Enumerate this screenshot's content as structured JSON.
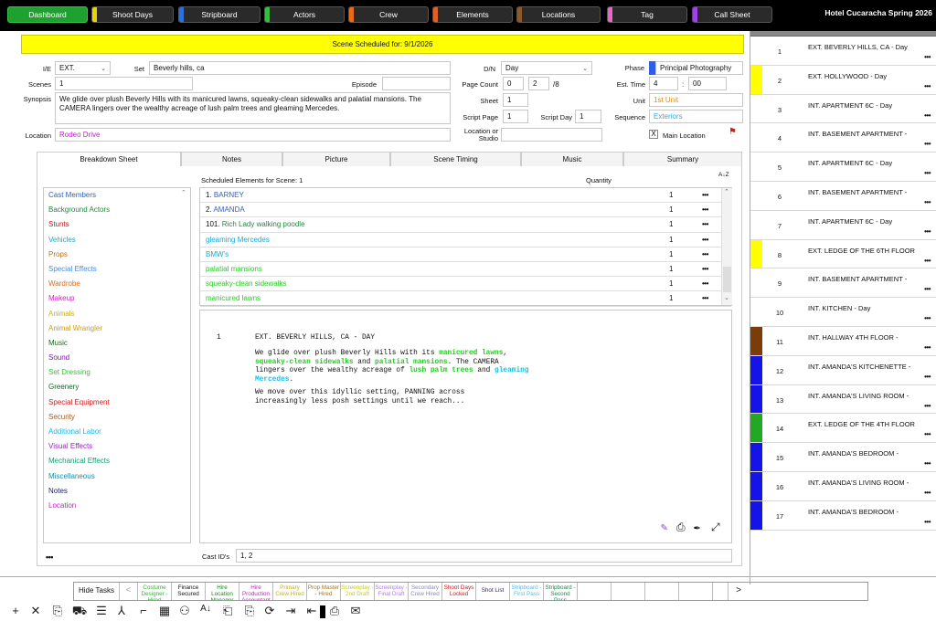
{
  "topnav": {
    "tabs": [
      {
        "label": "Dashboard",
        "color": "#1fa12f",
        "active": true
      },
      {
        "label": "Shoot Days",
        "color": "#e8d400"
      },
      {
        "label": "Stripboard",
        "color": "#2f6fd6"
      },
      {
        "label": "Actors",
        "color": "#3dbb3d"
      },
      {
        "label": "Crew",
        "color": "#e86b1a"
      },
      {
        "label": "Elements",
        "color": "#e0602a"
      },
      {
        "label": "Locations",
        "color": "#8a5a2a"
      },
      {
        "label": "Tag",
        "color": "#e868c8"
      },
      {
        "label": "Call Sheet",
        "color": "#a040e8"
      }
    ],
    "project_title": "Hotel Cucaracha Spring 2026"
  },
  "banner": "Scene Scheduled for: 9/1/2026",
  "form": {
    "ie_label": "I/E",
    "ie_value": "EXT.",
    "set_label": "Set",
    "set_value": "Beverly hills, ca",
    "dn_label": "D/N",
    "dn_value": "Day",
    "phase_label": "Phase",
    "phase_value": "Principal Photography",
    "scenes_label": "Scenes",
    "scenes_value": "1",
    "episode_label": "Episode",
    "episode_value": "",
    "pagecount_label": "Page Count",
    "pagecount_whole": "0",
    "pagecount_num": "2",
    "pagecount_den": "/8",
    "esttime_label": "Est. Time",
    "esttime_h": "4",
    "esttime_sep": ":",
    "esttime_m": "00",
    "synopsis_label": "Synopsis",
    "synopsis_value": "We glide over plush Beverly Hills with its manicured lawns, squeaky-clean sidewalks and palatial mansions. The CAMERA lingers over the wealthy acreage of lush palm trees and gleaming Mercedes.",
    "sheet_label": "Sheet",
    "sheet_value": "1",
    "unit_label": "Unit",
    "unit_value": "1st Unit",
    "scriptpage_label": "Script Page",
    "scriptpage_value": "1",
    "scriptday_label": "Script Day",
    "scriptday_value": "1",
    "sequence_label": "Sequence",
    "sequence_value": "Exteriors",
    "location_label": "Location",
    "location_value": "Rodeo Drive",
    "locstudio_label": "Location or Studio",
    "locstudio_value": "",
    "mainloc_check": "X",
    "mainloc_label": "Main Location"
  },
  "tabs": [
    "Breakdown Sheet",
    "Notes",
    "Picture",
    "Scene Timing",
    "Music",
    "Summary"
  ],
  "elements_header": "Scheduled Elements for Scene: 1",
  "quantity_header": "Quantity",
  "sort_glyph": "A↓Z",
  "categories": [
    {
      "label": "Cast Members",
      "color": "#2f5fc8"
    },
    {
      "label": "Background Actors",
      "color": "#1e8a3e"
    },
    {
      "label": "Stunts",
      "color": "#c01a1a"
    },
    {
      "label": "Vehicles",
      "color": "#17a8d8"
    },
    {
      "label": "Props",
      "color": "#b8741a"
    },
    {
      "label": "Special Effects",
      "color": "#4a8ad8"
    },
    {
      "label": "Wardrobe",
      "color": "#e06a1a"
    },
    {
      "label": "Makeup",
      "color": "#d81ac8"
    },
    {
      "label": "Animals",
      "color": "#c8b01a"
    },
    {
      "label": "Animal Wrangler",
      "color": "#c89a1a"
    },
    {
      "label": "Music",
      "color": "#1a6a1a"
    },
    {
      "label": "Sound",
      "color": "#7a1aa8"
    },
    {
      "label": "Set Dressing",
      "color": "#2ac82a"
    },
    {
      "label": "Greenery",
      "color": "#0a6a1a"
    },
    {
      "label": "Special Equipment",
      "color": "#d81a1a"
    },
    {
      "label": "Security",
      "color": "#a8581a"
    },
    {
      "label": "Additional Labor",
      "color": "#1ab8e8"
    },
    {
      "label": "Visual Effects",
      "color": "#9a1ac8"
    },
    {
      "label": "Mechanical Effects",
      "color": "#1a9a6a"
    },
    {
      "label": "Miscellaneous",
      "color": "#1a8aa8"
    },
    {
      "label": "Notes",
      "color": "#1a1a6a"
    },
    {
      "label": "Location",
      "color": "#c81ad8"
    }
  ],
  "categories_more": "•••",
  "elements": [
    {
      "prefix": "1. ",
      "name": "BARNEY",
      "color": "#2f5fc8",
      "qty": "1",
      "more": "•••"
    },
    {
      "prefix": "2. ",
      "name": "AMANDA",
      "color": "#2f5fc8",
      "qty": "1",
      "more": "•••"
    },
    {
      "prefix": "101. ",
      "name": "Rich Lady walking poodle",
      "color": "#1e8a3e",
      "qty": "1",
      "more": "•••"
    },
    {
      "prefix": "",
      "name": "gleaming Mercedes",
      "color": "#17a8d8",
      "qty": "1",
      "more": "•••"
    },
    {
      "prefix": "",
      "name": "BMW's",
      "color": "#17a8d8",
      "qty": "1",
      "more": "•••"
    },
    {
      "prefix": "",
      "name": "palatial mansions",
      "color": "#2ac82a",
      "qty": "1",
      "more": "•••"
    },
    {
      "prefix": "",
      "name": "squeaky-clean sidewalks",
      "color": "#2ac82a",
      "qty": "1",
      "more": "•••"
    },
    {
      "prefix": "",
      "name": "manicured lawns",
      "color": "#2ac82a",
      "qty": "1",
      "more": "•••"
    }
  ],
  "script": {
    "scene_num": "1",
    "heading": "EXT. BEVERLY HILLS, CA - DAY",
    "p1_a": "We glide over plush Beverly Hills with its ",
    "p1_hl1": "manicured lawns",
    "p1_b": ", ",
    "p1_hl2": "squeaky-clean sidewalks",
    "p1_c": " and ",
    "p1_hl3": "palatial mansions",
    "p1_d": ". The CAMERA lingers over the wealthy acreage of ",
    "p1_hl4": "lush palm trees",
    "p1_e": " and ",
    "p1_hl5": "gleaming Mercedes",
    "p1_f": ".",
    "p2": "We move over this idyllic setting, PANNING across increasingly less posh settings until we reach..."
  },
  "castids_label": "Cast ID's",
  "castids_value": "1, 2",
  "stripboard": [
    {
      "num": "1",
      "title": "EXT. BEVERLY HILLS, CA  - Day",
      "color": "#ffffff",
      "more": "•••"
    },
    {
      "num": "2",
      "title": "EXT. HOLLYWOOD  - Day",
      "color": "#ffff00",
      "more": "•••"
    },
    {
      "num": "3",
      "title": "INT. APARTMENT 6C  - Day",
      "color": "#ffffff",
      "more": "•••"
    },
    {
      "num": "4",
      "title": "INT. BASEMENT APARTMENT  -",
      "color": "#ffffff",
      "more": "•••"
    },
    {
      "num": "5",
      "title": "INT. APARTMENT 6C  - Day",
      "color": "#ffffff",
      "more": "•••"
    },
    {
      "num": "6",
      "title": "INT. BASEMENT APARTMENT  -",
      "color": "#ffffff",
      "more": "•••"
    },
    {
      "num": "7",
      "title": "INT. APARTMENT 6C  - Day",
      "color": "#ffffff",
      "more": "•••"
    },
    {
      "num": "8",
      "title": "EXT. LEDGE OF THE 6TH FLOOR",
      "color": "#ffff00",
      "more": "•••"
    },
    {
      "num": "9",
      "title": "INT. BASEMENT APARTMENT  -",
      "color": "#ffffff",
      "more": "•••"
    },
    {
      "num": "10",
      "title": "INT. KITCHEN  - Day",
      "color": "#ffffff",
      "more": "•••"
    },
    {
      "num": "11",
      "title": "INT. HALLWAY 4TH FLOOR  -",
      "color": "#7a3d0a",
      "more": "•••"
    },
    {
      "num": "12",
      "title": "INT. AMANDA'S KITCHENETTE  -",
      "color": "#1414e8",
      "more": "•••"
    },
    {
      "num": "13",
      "title": "INT. AMANDA'S LIVING ROOM  -",
      "color": "#1414e8",
      "more": "•••"
    },
    {
      "num": "14",
      "title": "EXT. LEDGE OF THE 4TH FLOOR",
      "color": "#22a822",
      "more": "•••"
    },
    {
      "num": "15",
      "title": "INT. AMANDA'S BEDROOM  -",
      "color": "#1414e8",
      "more": "•••"
    },
    {
      "num": "16",
      "title": "INT. AMANDA'S LIVING ROOM  -",
      "color": "#1414e8",
      "more": "•••"
    },
    {
      "num": "17",
      "title": "INT. AMANDA'S BEDROOM  -",
      "color": "#1414e8",
      "more": "•••"
    }
  ],
  "tasks": {
    "hide_label": "Hide Tasks",
    "prev": "<",
    "next": ">",
    "items": [
      {
        "label": "Costume Designer - Hired",
        "color": "#2ab82a"
      },
      {
        "label": "Finance Secured",
        "color": "#111111"
      },
      {
        "label": "Hire Location Manager",
        "color": "#1a8a1a"
      },
      {
        "label": "Hire Production Accountant",
        "color": "#c81ac8"
      },
      {
        "label": "Primary Crew Hired",
        "color": "#c8b01a"
      },
      {
        "label": "Prop Master - Hired",
        "color": "#a8741a"
      },
      {
        "label": "Screenplay - 2nd Draft",
        "color": "#c8c81a"
      },
      {
        "label": "Screenplay - Final Draft",
        "color": "#b87ae8"
      },
      {
        "label": "Secondary Crew Hired",
        "color": "#8a8ab8"
      },
      {
        "label": "Shoot Days Locked",
        "color": "#c81a1a"
      },
      {
        "label": "Shot List",
        "color": "#3a1a6a"
      },
      {
        "label": "Stripboard - First Pass",
        "color": "#5ab8e8"
      },
      {
        "label": "Stripboard - Second Pass",
        "color": "#1a8a4a"
      }
    ]
  },
  "toolbar": {
    "icons": [
      "+",
      "✕",
      "⎘",
      "⛟",
      "☰",
      "⅄",
      "⌐",
      "▦",
      "⚇",
      "A↓",
      "⎗",
      "⎘",
      "⟳",
      "⇥",
      "⇤",
      "▢",
      "⎙",
      "✉"
    ]
  }
}
